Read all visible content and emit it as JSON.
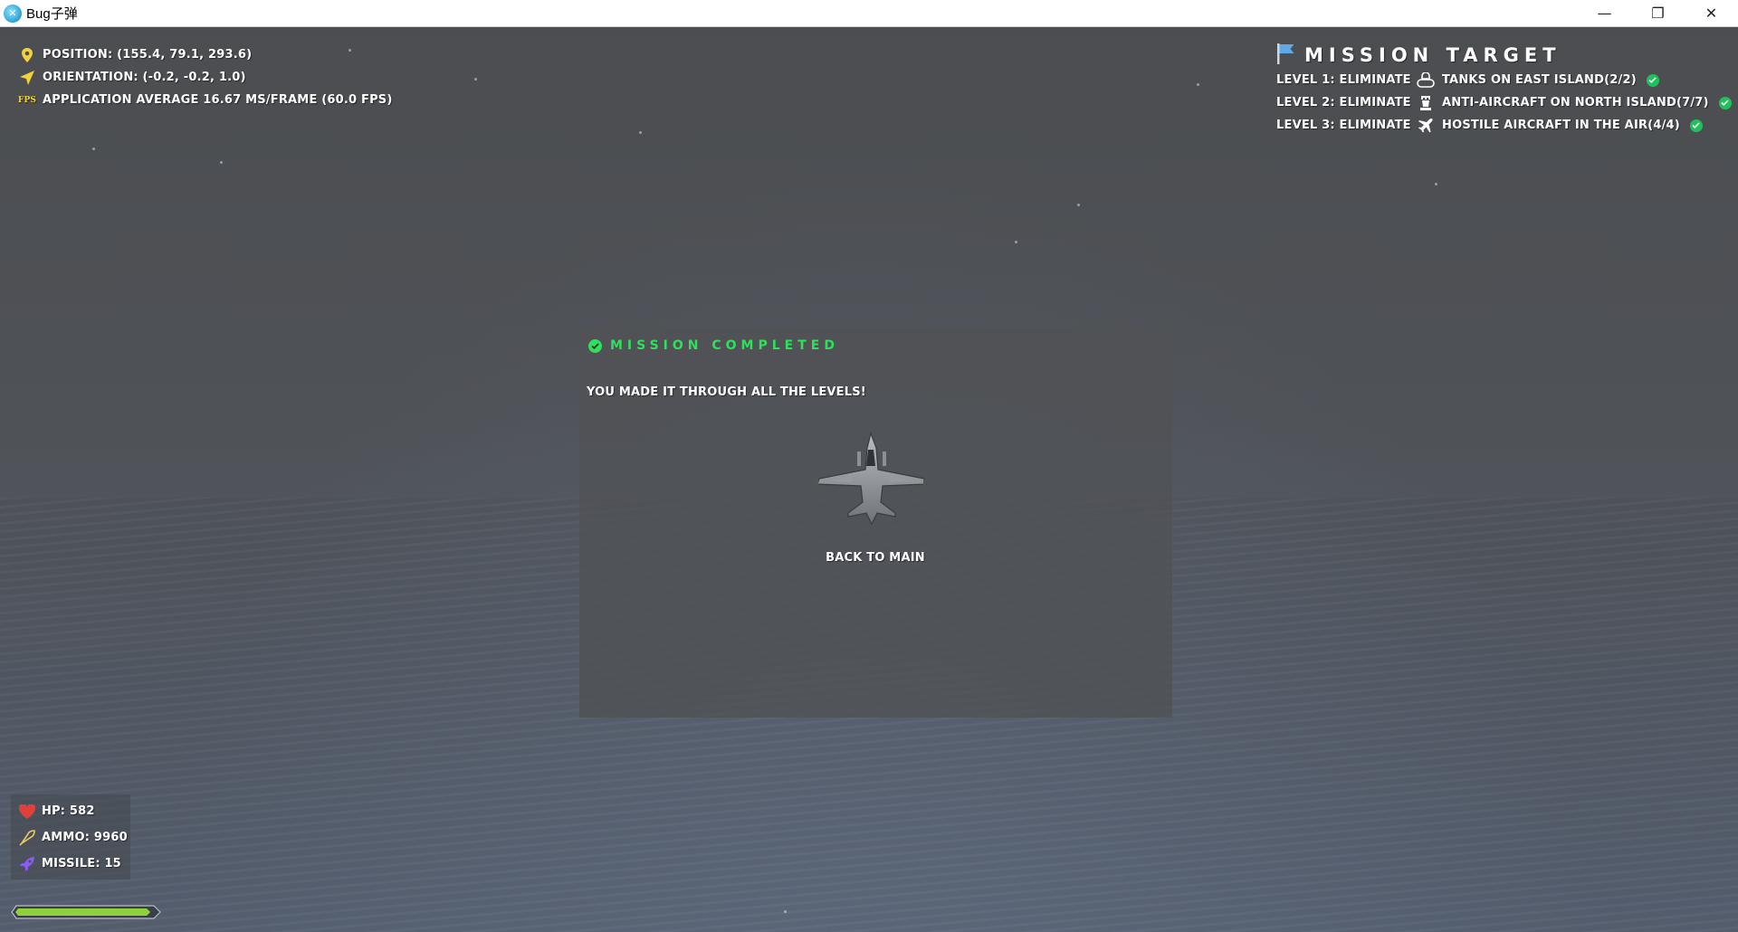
{
  "window": {
    "title": "Bug子弹",
    "controls": {
      "minimize": "—",
      "restore": "❐",
      "close": "✕"
    }
  },
  "hud": {
    "position": "Position: (155.4, 79.1, 293.6)",
    "orientation": "Orientation: (-0.2, -0.2, 1.0)",
    "fps_label": "FPS",
    "fps": "Application average 16.67 ms/frame (60.0 FPS)"
  },
  "mission_target": {
    "title": "MISSION TARGET",
    "rows": [
      {
        "level": "Level 1: Eliminate",
        "icon": "tank-icon",
        "text": "Tanks on East Island(2/2)",
        "done": true
      },
      {
        "level": "Level 2: Eliminate",
        "icon": "anti-aircraft-icon",
        "text": "Anti-aircraft on North Island(7/7)",
        "done": true
      },
      {
        "level": "Level 3: Eliminate",
        "icon": "plane-icon",
        "text": "Hostile aircraft in the air(4/4)",
        "done": true
      }
    ]
  },
  "dialog": {
    "title": "MISSION COMPLETED",
    "message": "You made it through all the levels!",
    "back_button": "Back to Main"
  },
  "resources": {
    "hp": "HP: 582",
    "ammo": "Ammo: 9960",
    "missile": "Missile: 15"
  },
  "health_bar": {
    "fill": 0.96
  },
  "colors": {
    "accent_green": "#2ee05a",
    "check_green": "#1fc25a",
    "hp_red": "#e0403a",
    "missile_purple": "#8a5cf0",
    "icon_yellow": "#f2d23a"
  }
}
